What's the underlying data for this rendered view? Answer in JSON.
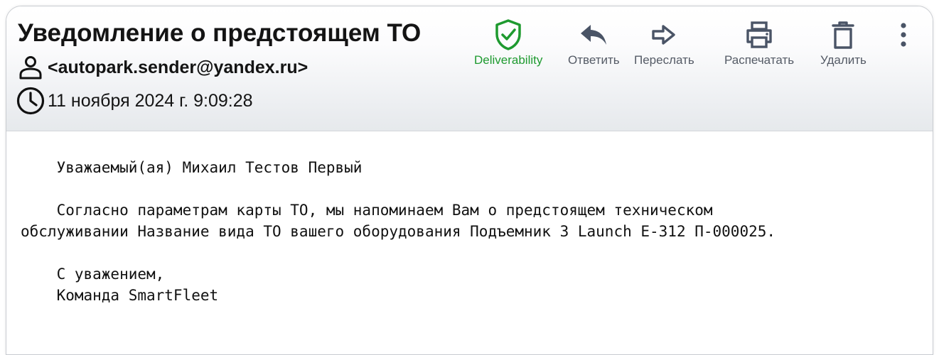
{
  "email": {
    "subject": "Уведомление о предстоящем ТО",
    "sender": "<autopark.sender@yandex.ru>",
    "date": "11 ноября 2024 г. 9:09:28",
    "body": "    Уважаемый(ая) Михаил Тестов Первый\n\n    Согласно параметрам карты ТО, мы напоминаем Вам о предстоящем техническом\nобслуживании Название вида ТО вашего оборудования Подъемник 3 Launch E-312 П-000025.\n\n    С уважением,\n    Команда SmartFleet"
  },
  "toolbar": {
    "deliverability": {
      "label": "Deliverability",
      "icon": "shield-check-icon",
      "color": "#1e9a2f"
    },
    "reply": {
      "label": "Ответить",
      "icon": "reply-arrow-icon"
    },
    "forward": {
      "label": "Переслать",
      "icon": "forward-arrow-icon"
    },
    "print": {
      "label": "Распечатать",
      "icon": "printer-icon"
    },
    "delete": {
      "label": "Удалить",
      "icon": "trash-icon"
    },
    "more": {
      "icon": "more-vertical-icon"
    }
  },
  "colors": {
    "icon": "#4a5466",
    "green": "#1e9a2f",
    "label": "#555b66",
    "text": "#141414"
  }
}
